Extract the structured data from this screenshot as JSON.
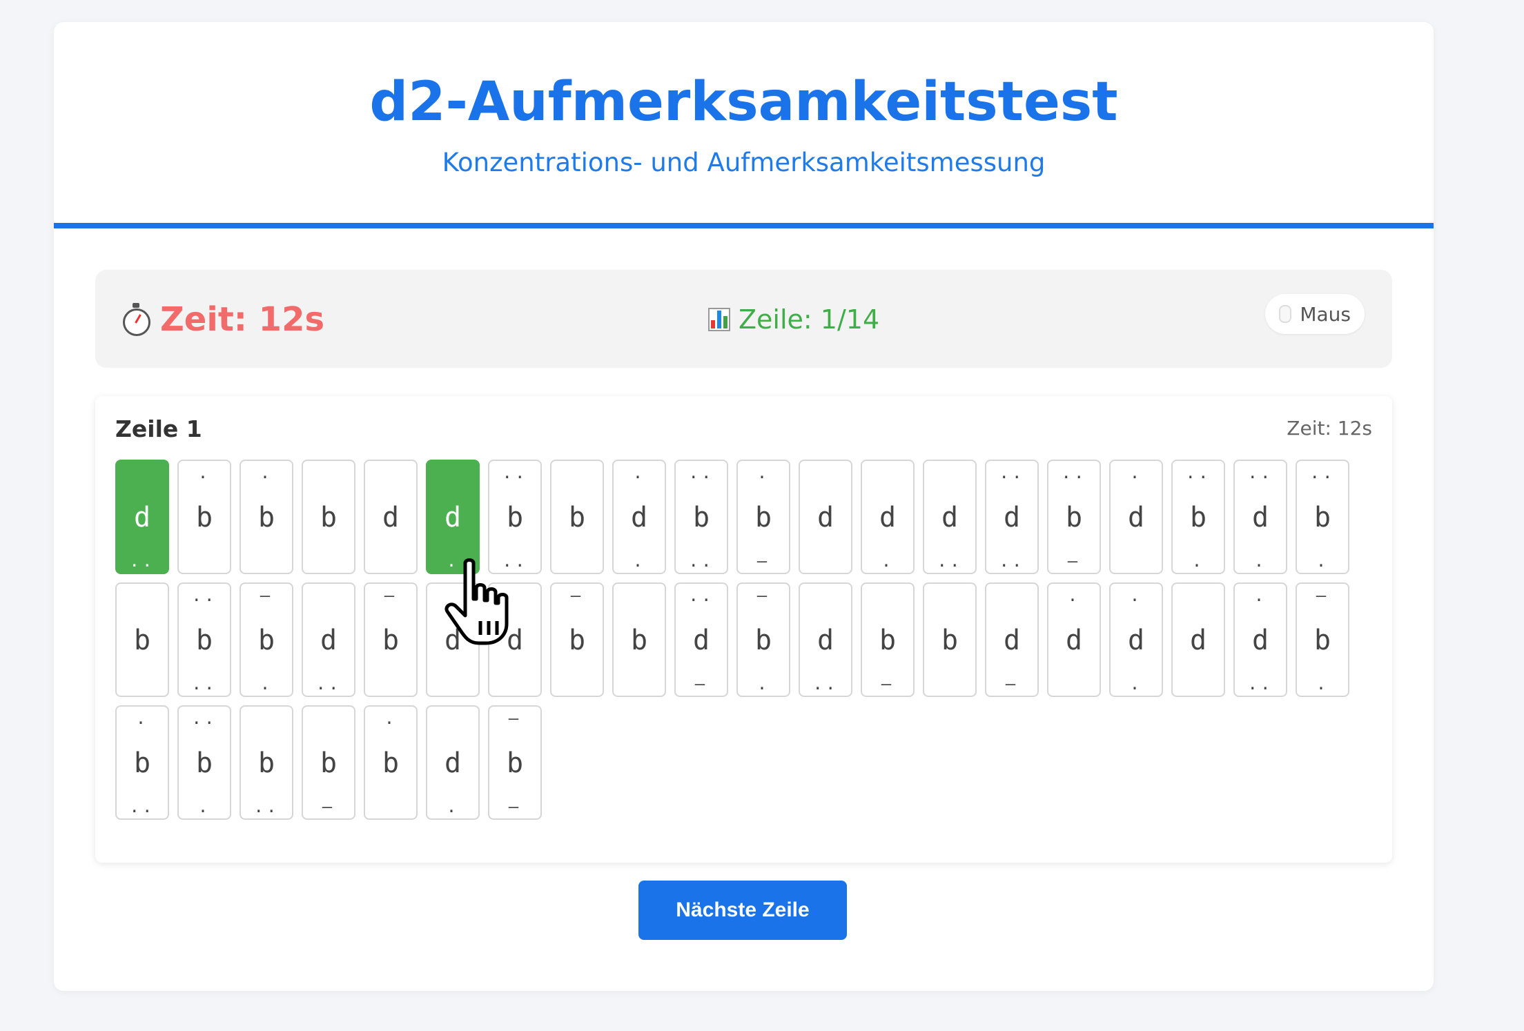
{
  "header": {
    "title": "d2-Aufmerksamkeitstest",
    "subtitle": "Konzentrations- und Aufmerksamkeitsmessung"
  },
  "statusbar": {
    "timer_icon": "stopwatch-icon",
    "timer_text": "Zeit: 12s",
    "row_icon": "bar-chart-icon",
    "row_text": "Zeile: 1/14",
    "mode_icon": "mouse-icon",
    "mode_label": "Maus"
  },
  "panel": {
    "title": "Zeile 1",
    "time": "Zeit: 12s"
  },
  "colors": {
    "accent": "#1a73e8",
    "timer": "#f26b6b",
    "row_info": "#3fae49",
    "selected": "#4caf50"
  },
  "items": [
    {
      "letter": "d",
      "top": "",
      ":bottom": "",
      "bottom": "..",
      "selected": true
    },
    {
      "letter": "b",
      "top": ".",
      "bottom": "",
      "selected": false
    },
    {
      "letter": "b",
      "top": ".",
      "bottom": "",
      "selected": false
    },
    {
      "letter": "b",
      "top": "",
      "bottom": "",
      "selected": false
    },
    {
      "letter": "d",
      "top": "",
      "bottom": "",
      "selected": false
    },
    {
      "letter": "d",
      "top": "",
      "bottom": ".",
      "selected": true
    },
    {
      "letter": "b",
      "top": "..",
      "bottom": "..",
      "selected": false
    },
    {
      "letter": "b",
      "top": "",
      "bottom": "",
      "selected": false
    },
    {
      "letter": "d",
      "top": ".",
      "bottom": ".",
      "selected": false
    },
    {
      "letter": "b",
      "top": "..",
      "bottom": "..",
      "selected": false
    },
    {
      "letter": "b",
      "top": ".",
      "bottom": "–",
      "selected": false
    },
    {
      "letter": "d",
      "top": "",
      "bottom": "",
      "selected": false
    },
    {
      "letter": "d",
      "top": "",
      "bottom": ".",
      "selected": false
    },
    {
      "letter": "d",
      "top": "",
      "bottom": "..",
      "selected": false
    },
    {
      "letter": "d",
      "top": "..",
      "bottom": "..",
      "selected": false
    },
    {
      "letter": "b",
      "top": "..",
      "bottom": "–",
      "selected": false
    },
    {
      "letter": "d",
      "top": ".",
      "bottom": "",
      "selected": false
    },
    {
      "letter": "b",
      "top": "..",
      "bottom": ".",
      "selected": false
    },
    {
      "letter": "d",
      "top": "..",
      "bottom": ".",
      "selected": false
    },
    {
      "letter": "b",
      "top": "..",
      "bottom": ".",
      "selected": false
    },
    {
      "letter": "b",
      "top": "",
      "bottom": "",
      "selected": false
    },
    {
      "letter": "b",
      "top": "..",
      "bottom": "..",
      "selected": false
    },
    {
      "letter": "b",
      "top": "–",
      "bottom": ".",
      "selected": false
    },
    {
      "letter": "d",
      "top": "",
      "bottom": "..",
      "selected": false
    },
    {
      "letter": "b",
      "top": "–",
      "bottom": "",
      "selected": false
    },
    {
      "letter": "d",
      "top": "",
      "bottom": "",
      "selected": false
    },
    {
      "letter": "d",
      "top": "",
      "bottom": "",
      "selected": false
    },
    {
      "letter": "b",
      "top": "–",
      "bottom": "",
      "selected": false
    },
    {
      "letter": "b",
      "top": "",
      "bottom": "",
      "selected": false
    },
    {
      "letter": "d",
      "top": "..",
      "bottom": "–",
      "selected": false
    },
    {
      "letter": "b",
      "top": "–",
      "bottom": ".",
      "selected": false
    },
    {
      "letter": "d",
      "top": "",
      "bottom": "..",
      "selected": false
    },
    {
      "letter": "b",
      "top": "",
      "bottom": "–",
      "selected": false
    },
    {
      "letter": "b",
      "top": "",
      "bottom": "",
      "selected": false
    },
    {
      "letter": "d",
      "top": "",
      "bottom": "–",
      "selected": false
    },
    {
      "letter": "d",
      "top": ".",
      "bottom": "",
      "selected": false
    },
    {
      "letter": "d",
      "top": ".",
      "bottom": ".",
      "selected": false
    },
    {
      "letter": "d",
      "top": "",
      "bottom": "",
      "selected": false
    },
    {
      "letter": "d",
      "top": ".",
      "bottom": "..",
      "selected": false
    },
    {
      "letter": "b",
      "top": "–",
      "bottom": ".",
      "selected": false
    },
    {
      "letter": "b",
      "top": ".",
      "bottom": "..",
      "selected": false
    },
    {
      "letter": "b",
      "top": "..",
      "bottom": ".",
      "selected": false
    },
    {
      "letter": "b",
      "top": "",
      "bottom": "..",
      "selected": false
    },
    {
      "letter": "b",
      "top": "",
      "bottom": "–",
      "selected": false
    },
    {
      "letter": "b",
      "top": ".",
      "bottom": "",
      "selected": false
    },
    {
      "letter": "d",
      "top": "",
      "bottom": ".",
      "selected": false
    },
    {
      "letter": "b",
      "top": "–",
      "bottom": "–",
      "selected": false
    }
  ],
  "next_button": {
    "label": "Nächste Zeile"
  },
  "cursor_icon": "hand-pointer-icon"
}
